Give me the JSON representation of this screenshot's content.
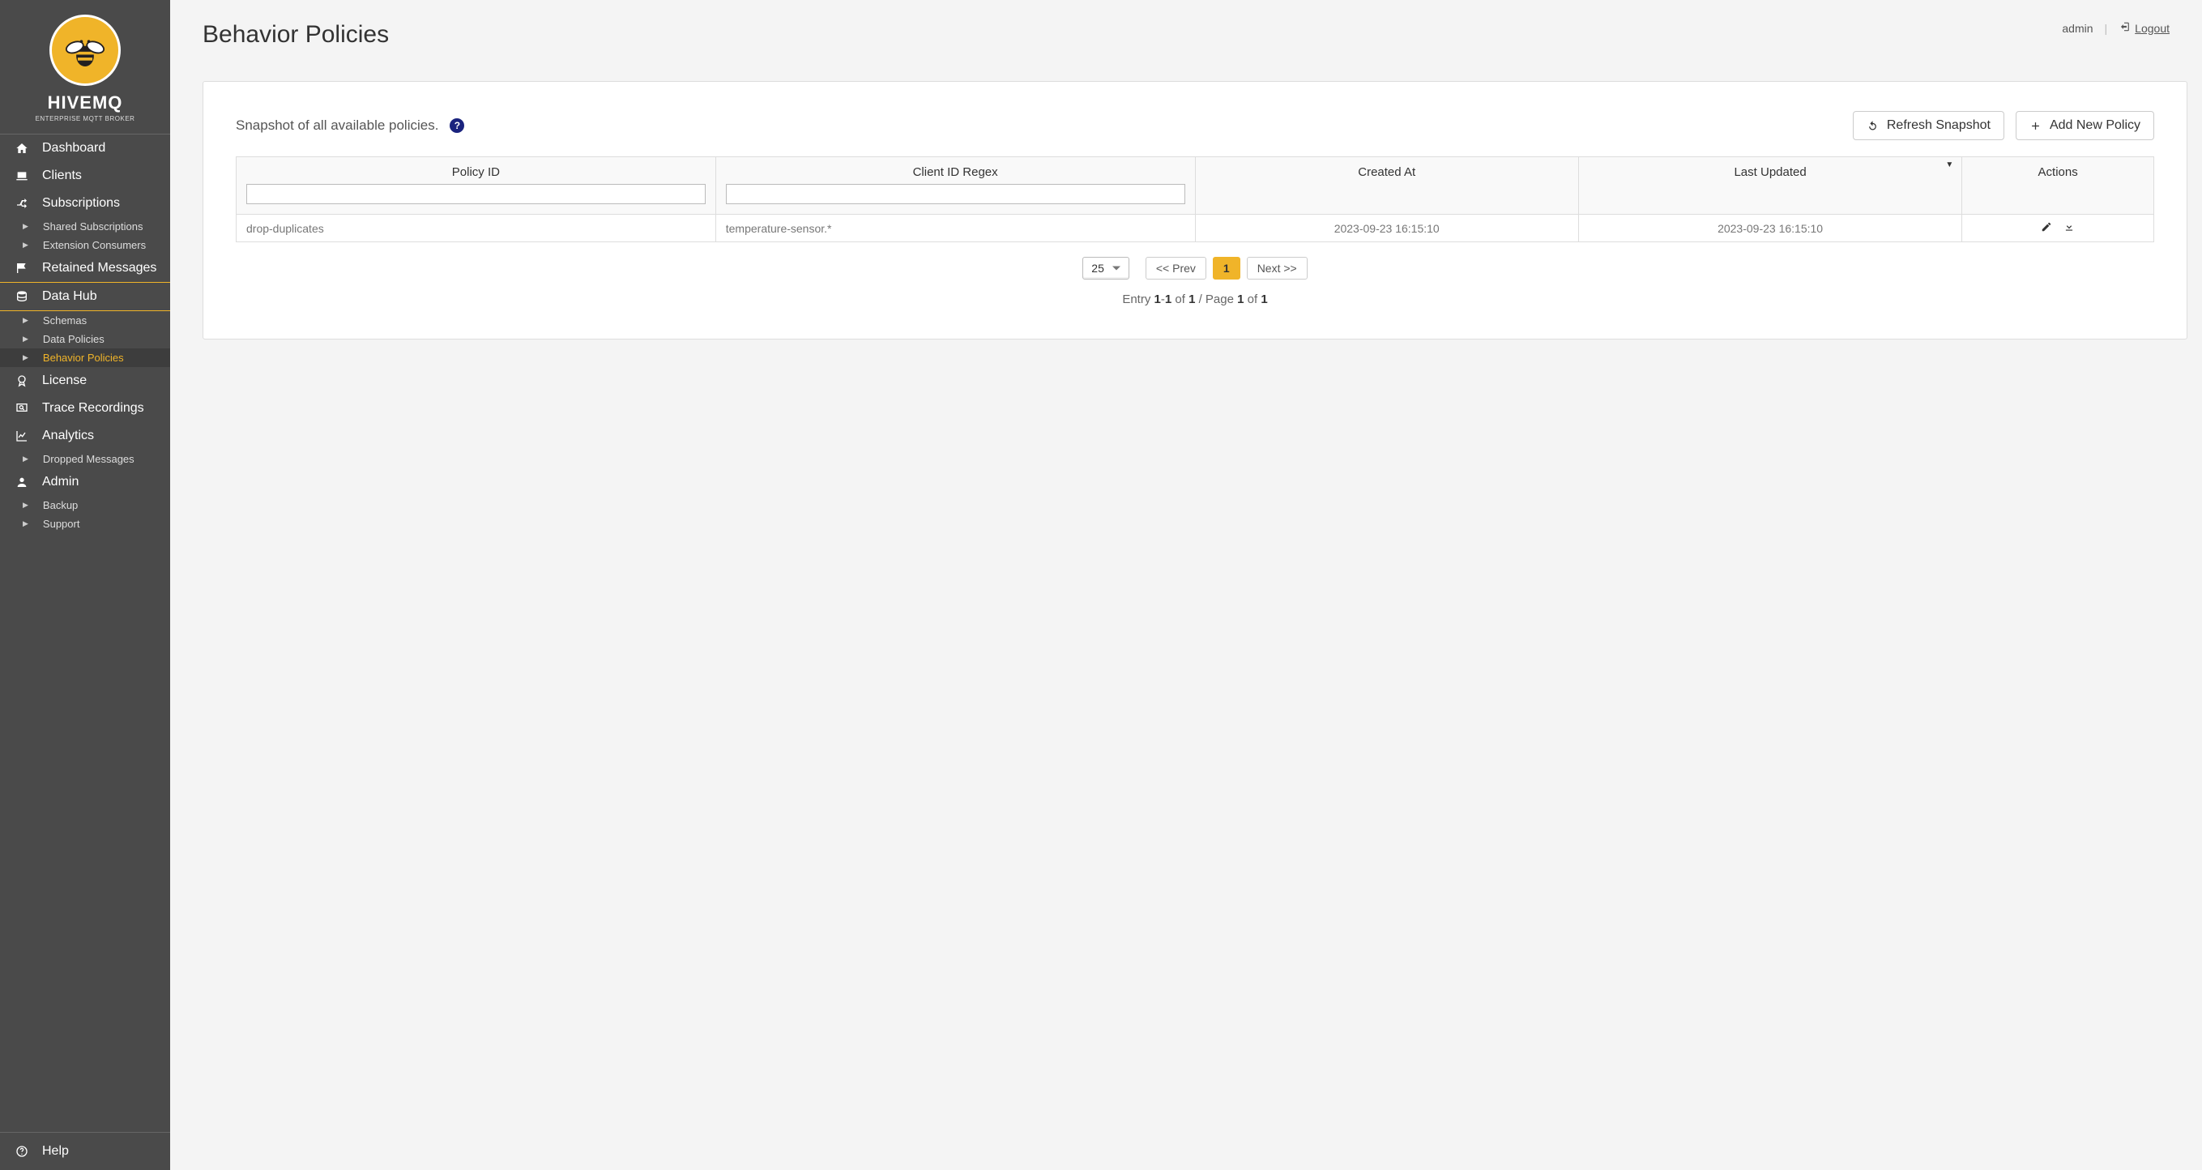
{
  "brand": {
    "name": "HIVEMQ",
    "tagline": "ENTERPRISE MQTT BROKER"
  },
  "sidebar": {
    "dashboard": "Dashboard",
    "clients": "Clients",
    "subscriptions": "Subscriptions",
    "shared_subscriptions": "Shared Subscriptions",
    "extension_consumers": "Extension Consumers",
    "retained_messages": "Retained Messages",
    "data_hub": "Data Hub",
    "schemas": "Schemas",
    "data_policies": "Data Policies",
    "behavior_policies": "Behavior Policies",
    "license": "License",
    "trace_recordings": "Trace Recordings",
    "analytics": "Analytics",
    "dropped_messages": "Dropped Messages",
    "admin": "Admin",
    "backup": "Backup",
    "support": "Support",
    "help": "Help"
  },
  "header": {
    "page_title": "Behavior Policies",
    "username": "admin",
    "logout": "Logout"
  },
  "panel": {
    "snapshot_text": "Snapshot of all available policies.",
    "refresh_label": "Refresh Snapshot",
    "add_label": "Add New Policy"
  },
  "table": {
    "columns": {
      "policy_id": "Policy ID",
      "client_id_regex": "Client ID Regex",
      "created_at": "Created At",
      "last_updated": "Last Updated",
      "actions": "Actions"
    },
    "filters": {
      "policy_id": "",
      "client_id_regex": ""
    },
    "rows": [
      {
        "policy_id": "drop-duplicates",
        "client_id_regex": "temperature-sensor.*",
        "created_at": "2023-09-23 16:15:10",
        "last_updated": "2023-09-23 16:15:10"
      }
    ]
  },
  "pagination": {
    "page_size": "25",
    "prev": "<< Prev",
    "current": "1",
    "next": "Next >>",
    "entry_info_prefix": "Entry ",
    "entry_from": "1",
    "entry_dash": "-",
    "entry_to": "1",
    "of1": " of ",
    "entry_total": "1",
    "page_sep": " / Page ",
    "page_current": "1",
    "of2": " of ",
    "page_total": "1"
  }
}
